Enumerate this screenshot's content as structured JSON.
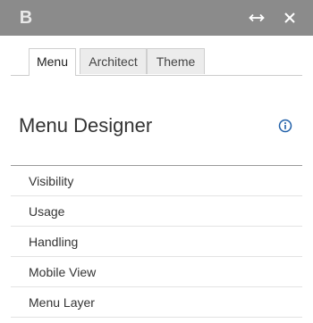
{
  "header": {
    "logo_letter": "B",
    "expand_icon": "horizontal-arrows-icon",
    "close_icon": "close-icon"
  },
  "tabs": [
    {
      "label": "Menu",
      "active": true
    },
    {
      "label": "Architect",
      "active": false
    },
    {
      "label": "Theme",
      "active": false
    }
  ],
  "panel": {
    "title": "Menu Designer",
    "info_icon": "info-icon"
  },
  "menu_items": [
    {
      "label": "Visibility"
    },
    {
      "label": "Usage"
    },
    {
      "label": "Handling"
    },
    {
      "label": "Mobile View"
    },
    {
      "label": "Menu Layer"
    }
  ],
  "colors": {
    "topbar": "#8b8b8b",
    "accent": "#1f5fa8"
  }
}
